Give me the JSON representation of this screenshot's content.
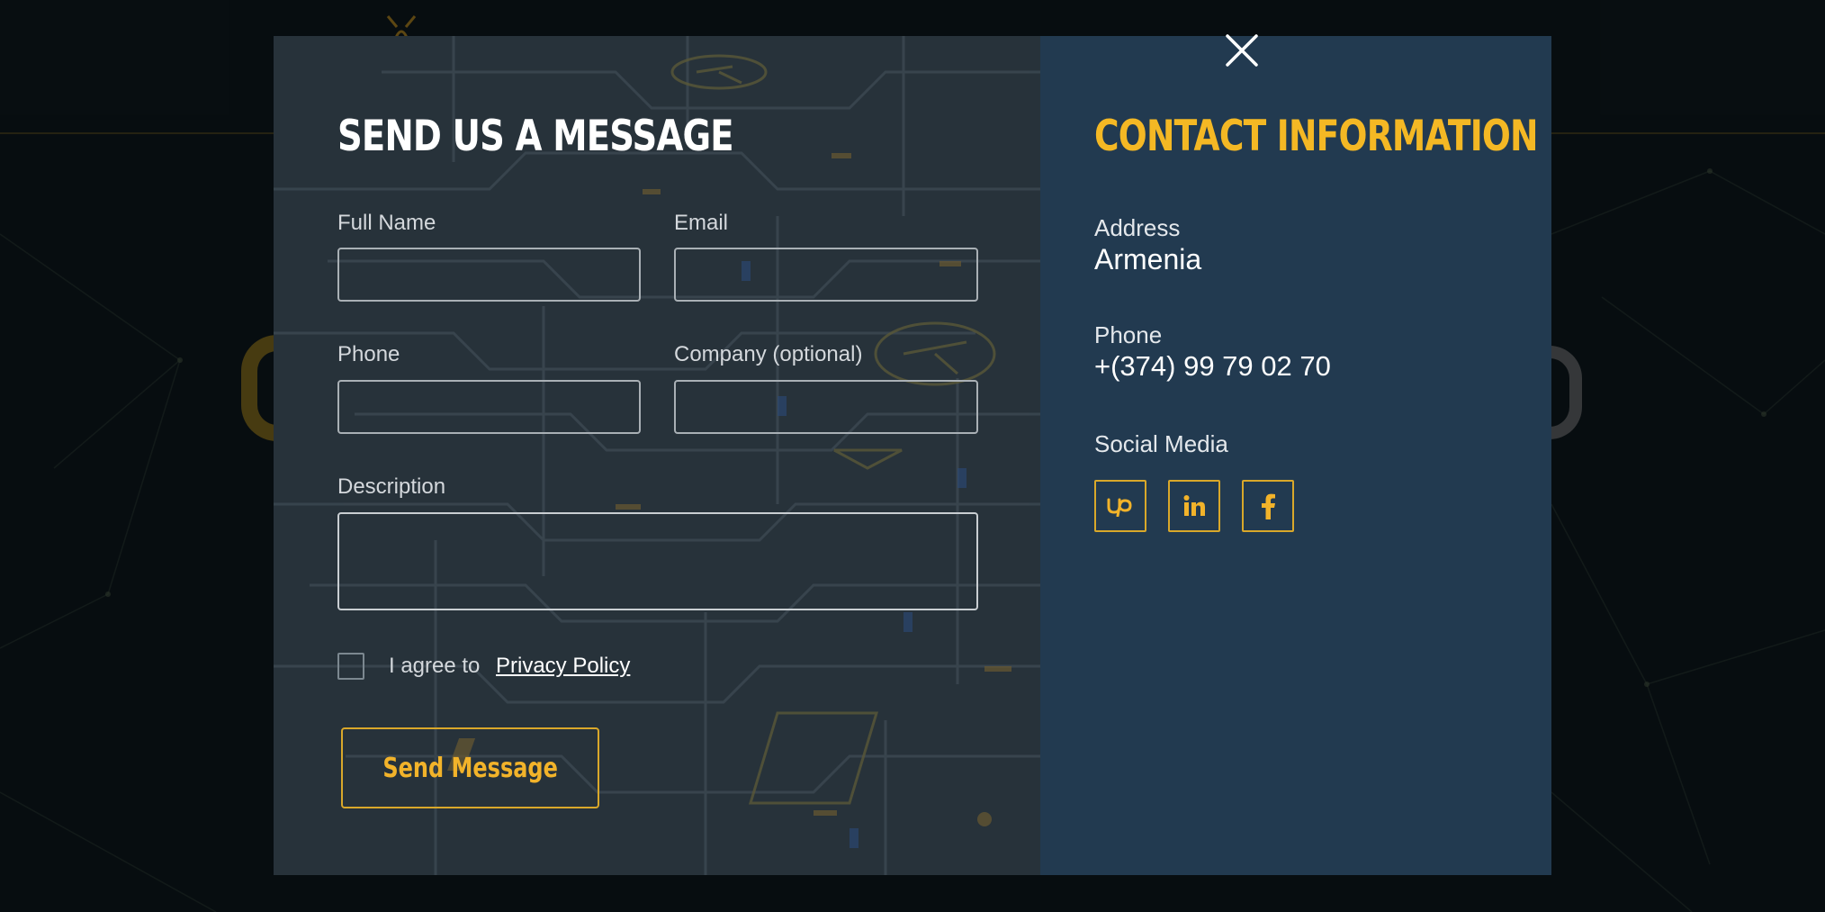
{
  "form": {
    "title": "SEND US A MESSAGE",
    "full_name_label": "Full Name",
    "full_name_value": "",
    "email_label": "Email",
    "email_value": "",
    "phone_label": "Phone",
    "phone_value": "",
    "company_label": "Company (optional)",
    "company_value": "",
    "description_label": "Description",
    "description_value": "",
    "agree_text": "I agree to",
    "privacy_link": "Privacy Policy",
    "submit_label": "Send Message"
  },
  "contact": {
    "title": "CONTACT INFORMATION",
    "address_label": "Address",
    "address_value": "Armenia",
    "phone_label": "Phone",
    "phone_value": "+(374) 99 79 02 70",
    "social_label": "Social Media",
    "social": [
      {
        "icon": "upwork-icon"
      },
      {
        "icon": "linkedin-icon"
      },
      {
        "icon": "facebook-icon"
      }
    ]
  },
  "colors": {
    "accent": "#f2b32a",
    "form_bg": "#27323a",
    "info_bg": "#223a50",
    "page_bg": "#0d151a"
  }
}
